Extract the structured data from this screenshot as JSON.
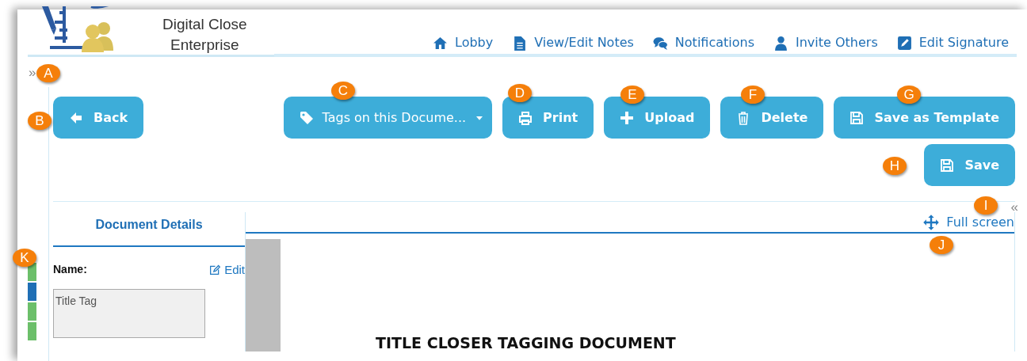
{
  "header": {
    "app_name_lines": [
      "Digital Close",
      "Enterprise"
    ],
    "nav": [
      {
        "label": "Lobby"
      },
      {
        "label": "View/Edit Notes"
      },
      {
        "label": "Notifications"
      },
      {
        "label": "Invite Others"
      },
      {
        "label": "Edit Signature"
      }
    ]
  },
  "sidebar": {
    "toggle": "»",
    "status_bars": [
      {
        "color": "#6cbf6a"
      },
      {
        "color": "#1f6fb5"
      },
      {
        "color": "#6cbf6a"
      },
      {
        "color": "#6cbf6a"
      }
    ]
  },
  "toolbar": {
    "back": {
      "label": "Back"
    },
    "actions": [
      {
        "label": "Tags on this Docume...",
        "kind": "dropdown"
      },
      {
        "label": "Print",
        "kind": "button"
      },
      {
        "label": "Upload",
        "kind": "button"
      },
      {
        "label": "Delete",
        "kind": "button"
      },
      {
        "label": "Save as Template",
        "kind": "button"
      }
    ],
    "save": {
      "label": "Save"
    }
  },
  "panel_toggle": "«",
  "details": {
    "tabs": [
      {
        "label": "Document Details",
        "selected": true
      }
    ],
    "name_label": "Name:",
    "edit_link": "Edit",
    "name_value": "Title Tag"
  },
  "viewer": {
    "full_screen": "Full screen",
    "document_title": "TITLE CLOSER TAGGING DOCUMENT"
  },
  "callouts": [
    "A",
    "B",
    "C",
    "D",
    "E",
    "F",
    "G",
    "H",
    "I",
    "J",
    "K"
  ]
}
